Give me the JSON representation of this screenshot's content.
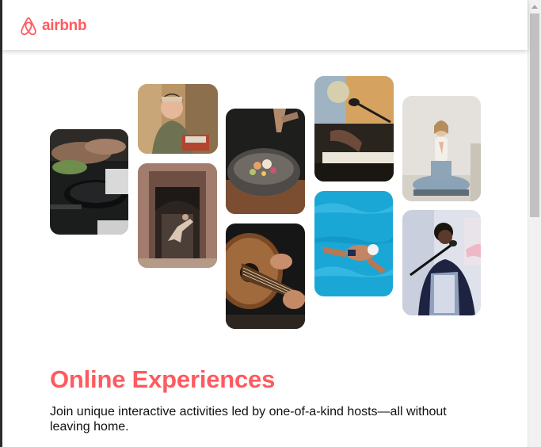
{
  "header": {
    "logo_text": "airbnb",
    "brand_color": "#FF5A5F"
  },
  "gallery": {
    "photos": [
      {
        "subject": "cooking-pan-photo"
      },
      {
        "subject": "woman-cooking-host-photo"
      },
      {
        "subject": "dancer-doorway-photo"
      },
      {
        "subject": "food-bowl-photo"
      },
      {
        "subject": "acoustic-guitar-photo"
      },
      {
        "subject": "piano-microphone-photo"
      },
      {
        "subject": "swimmer-pool-photo"
      },
      {
        "subject": "yoga-meditation-photo"
      },
      {
        "subject": "singer-microphone-photo"
      }
    ]
  },
  "hero": {
    "title": "Online Experiences",
    "subtitle": "Join unique interactive activities led by one-of-a-kind hosts—all without leaving home."
  }
}
